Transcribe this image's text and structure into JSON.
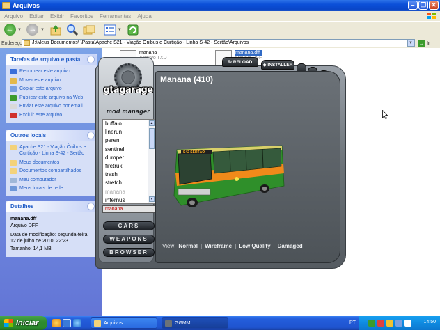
{
  "window": {
    "title": "Arquivos",
    "menu": [
      "Arquivo",
      "Editar",
      "Exibir",
      "Favoritos",
      "Ferramentas",
      "Ajuda"
    ],
    "address_label": "Endereço",
    "address_value": "J:\\Meus Documentos\\                                                    \\Pasta\\Apache S21 - Viação Ônibus e Curtição - Linha S-42 - Sertão\\Arquivos",
    "go_label": "Ir"
  },
  "tasks_panel": {
    "title": "Tarefas de arquivo e pasta",
    "items": [
      {
        "label": "Renomear este arquivo",
        "icon": "rename-icon",
        "color": "#3a6fd8"
      },
      {
        "label": "Mover este arquivo",
        "icon": "move-icon",
        "color": "#e4b94a"
      },
      {
        "label": "Copiar este arquivo",
        "icon": "copy-icon",
        "color": "#7aa0e0"
      },
      {
        "label": "Publicar este arquivo na Web",
        "icon": "publish-web-icon",
        "color": "#3c9b2c"
      },
      {
        "label": "Enviar este arquivo por email",
        "icon": "email-icon",
        "color": "#d9d9d9"
      },
      {
        "label": "Excluir este arquivo",
        "icon": "delete-icon",
        "color": "#d0312d"
      }
    ]
  },
  "places_panel": {
    "title": "Outros locais",
    "items": [
      {
        "label": "Apache S21 - Viação Ônibus e Curtição - Linha S-42 - Sertão",
        "icon": "folder-icon",
        "color": "#f3d27a"
      },
      {
        "label": "Meus documentos",
        "icon": "my-documents-icon",
        "color": "#f3d27a"
      },
      {
        "label": "Documentos compartilhados",
        "icon": "shared-documents-icon",
        "color": "#f3d27a"
      },
      {
        "label": "Meu computador",
        "icon": "my-computer-icon",
        "color": "#9fb8d8"
      },
      {
        "label": "Meus locais de rede",
        "icon": "network-places-icon",
        "color": "#6f98d8"
      }
    ]
  },
  "details_panel": {
    "title": "Detalhes",
    "name": "manana.dff",
    "type": "Arquivo DFF",
    "modified": "Data de modificação: segunda-feira, 12 de julho de 2010, 22:23",
    "size": "Tamanho: 14,1 MB"
  },
  "files": [
    {
      "name": "manana",
      "type": "Arquivo TXD"
    },
    {
      "name": "manana.dff",
      "type": "Arquivo DFF"
    }
  ],
  "mod_manager": {
    "logo": "gtagarage",
    "subtitle": "mod manager",
    "reload_label": "RELOAD",
    "installer_label": "INSTALLER",
    "vehicle_title": "Manana (410)",
    "list": [
      {
        "name": "buffalo",
        "dim": false
      },
      {
        "name": "linerun",
        "dim": false
      },
      {
        "name": "peren",
        "dim": false
      },
      {
        "name": "sentinel",
        "dim": false
      },
      {
        "name": "dumper",
        "dim": false
      },
      {
        "name": "firetruk",
        "dim": false
      },
      {
        "name": "trash",
        "dim": false
      },
      {
        "name": "stretch",
        "dim": false
      },
      {
        "name": "manana",
        "dim": true
      },
      {
        "name": "infernus",
        "dim": false
      }
    ],
    "selected": "manana",
    "nav_buttons": [
      "CARS",
      "WEAPONS",
      "BROWSER"
    ],
    "view_label": "View:",
    "view_options": [
      "Normal",
      "Wireframe",
      "Low Quality",
      "Damaged"
    ],
    "bus_route_label": "S42 SERTÃO",
    "bus_color": "#2f8f2a",
    "bus_stripe_color": "#f08a1a"
  },
  "taskbar": {
    "start_label": "Iniciar",
    "tasks": [
      "Arquivos",
      "GGMM"
    ],
    "language": "PT",
    "clock": "14:50"
  }
}
